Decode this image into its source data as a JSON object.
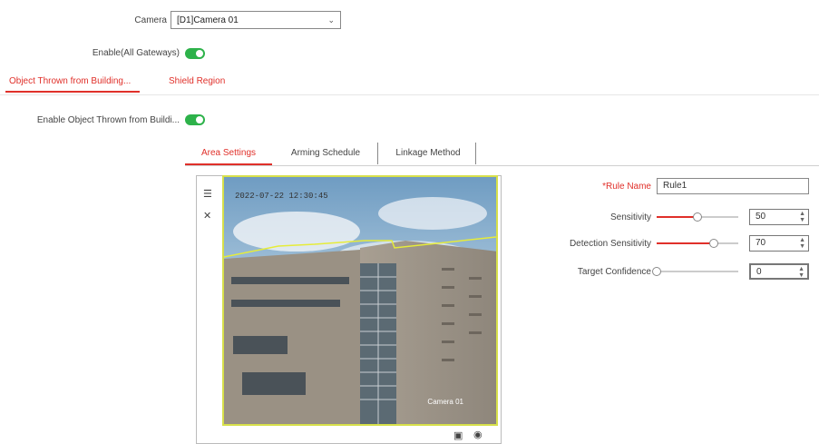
{
  "camera": {
    "label": "Camera",
    "value": "[D1]Camera 01"
  },
  "enable_label": "Enable(All Gateways)",
  "main_tabs": [
    {
      "label": "Object Thrown from Building..."
    },
    {
      "label": "Shield Region"
    }
  ],
  "enable_detection_label": "Enable Object Thrown from Buildi...",
  "sub_tabs": [
    {
      "label": "Area Settings"
    },
    {
      "label": "Arming Schedule"
    },
    {
      "label": "Linkage Method"
    }
  ],
  "video": {
    "osd_timestamp": "2022-07-22 12:30:45",
    "osd_camera": "Camera 01"
  },
  "form": {
    "rule_name": {
      "label": "*Rule Name",
      "value": "Rule1"
    },
    "sensitivity": {
      "label": "Sensitivity",
      "value": "50",
      "fraction": 0.5
    },
    "detection_sensitivity": {
      "label": "Detection Sensitivity",
      "value": "70",
      "fraction": 0.7
    },
    "target_confidence": {
      "label": "Target Confidence",
      "value": "0",
      "fraction": 0.0
    }
  },
  "colors": {
    "accent": "#e0302a",
    "toggle_on": "#2db24a"
  }
}
